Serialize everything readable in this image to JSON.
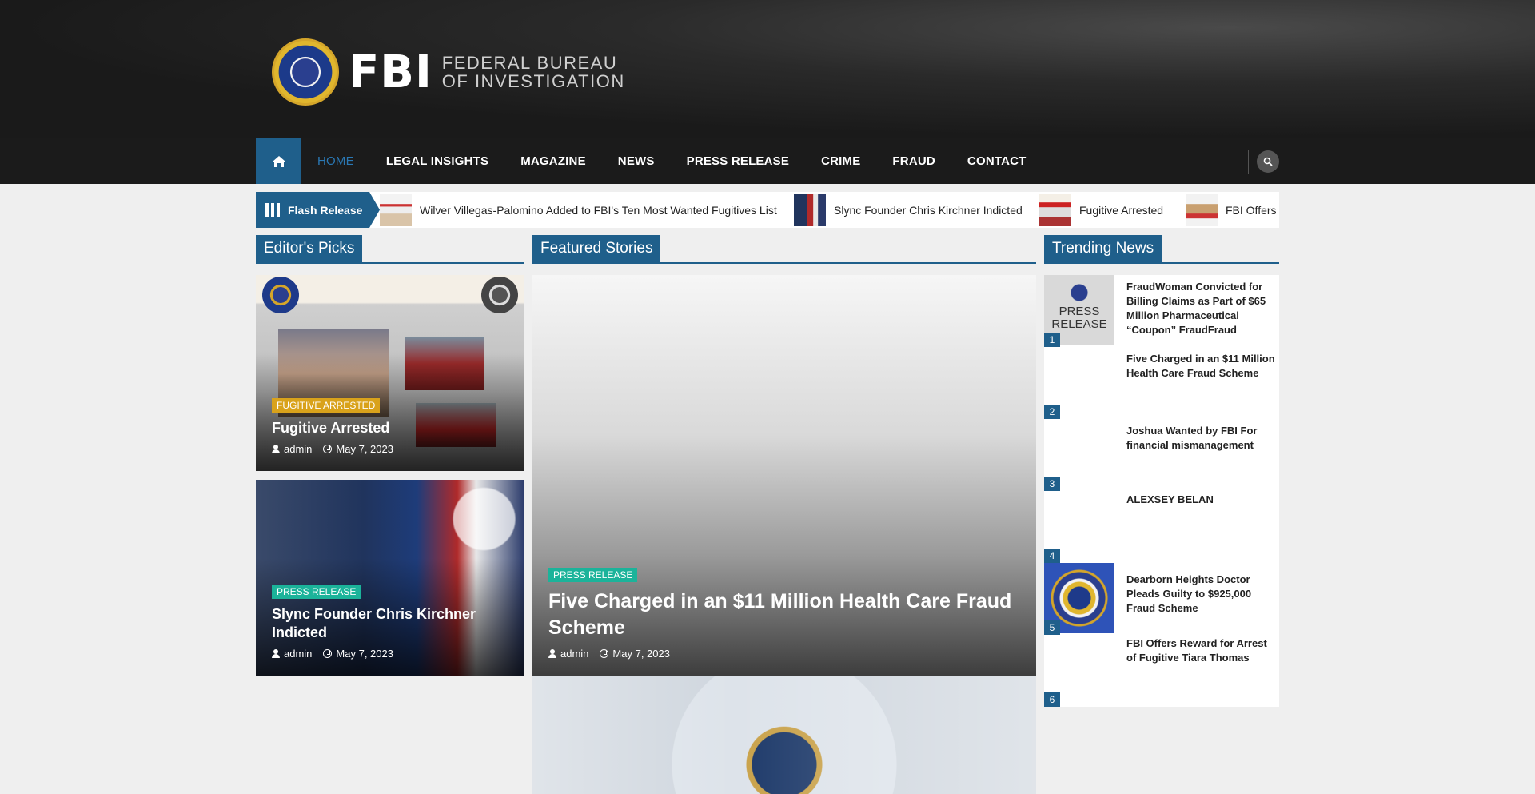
{
  "header": {
    "logo_text": "FBI",
    "logo_sub_line1": "FEDERAL BUREAU",
    "logo_sub_line2": "OF INVESTIGATION"
  },
  "nav": {
    "items": [
      {
        "label": "HOME",
        "active": true
      },
      {
        "label": "LEGAL INSIGHTS"
      },
      {
        "label": "MAGAZINE"
      },
      {
        "label": "NEWS"
      },
      {
        "label": "PRESS RELEASE"
      },
      {
        "label": "CRIME"
      },
      {
        "label": "FRAUD"
      },
      {
        "label": "CONTACT"
      }
    ],
    "home_icon": "home-icon",
    "search_icon": "search-icon"
  },
  "ticker": {
    "label": "Flash Release",
    "items": [
      {
        "text": "Wilver Villegas-Palomino Added to FBI's Ten Most Wanted Fugitives List"
      },
      {
        "text": "Slync Founder Chris Kirchner Indicted"
      },
      {
        "text": "Fugitive Arrested"
      },
      {
        "text": "FBI Offers I"
      }
    ]
  },
  "sections": {
    "editors_picks": "Editor's Picks",
    "featured": "Featured Stories",
    "trending": "Trending News"
  },
  "editors_picks": [
    {
      "tag": "FUGITIVE ARRESTED",
      "title": "Fugitive Arrested",
      "author": "admin",
      "date": "May 7, 2023"
    },
    {
      "tag": "PRESS RELEASE",
      "title": "Slync Founder Chris Kirchner Indicted",
      "author": "admin",
      "date": "May 7, 2023"
    }
  ],
  "featured": {
    "tag": "PRESS RELEASE",
    "title": "Five Charged in an $11 Million Health Care Fraud Scheme",
    "author": "admin",
    "date": "May 7, 2023"
  },
  "trending": [
    {
      "num": "1",
      "title": "FraudWoman Convicted for Billing Claims as Part of $65 Million Pharmaceutical “Coupon” FraudFraud"
    },
    {
      "num": "2",
      "title": "Five Charged in an $11 Million Health Care Fraud Scheme"
    },
    {
      "num": "3",
      "title": "Joshua Wanted by FBI For financial mismanagement"
    },
    {
      "num": "4",
      "title": "ALEXSEY BELAN"
    },
    {
      "num": "5",
      "title": "Dearborn Heights Doctor Pleads Guilty to $925,000 Fraud Scheme"
    },
    {
      "num": "6",
      "title": "FBI Offers Reward for Arrest of Fugitive Tiara Thomas"
    }
  ],
  "colors": {
    "brand_blue": "#1f5f8b",
    "tag_gold": "#d9a21b",
    "tag_teal": "#1bb39a",
    "nav_bg": "#1b1b1b"
  }
}
